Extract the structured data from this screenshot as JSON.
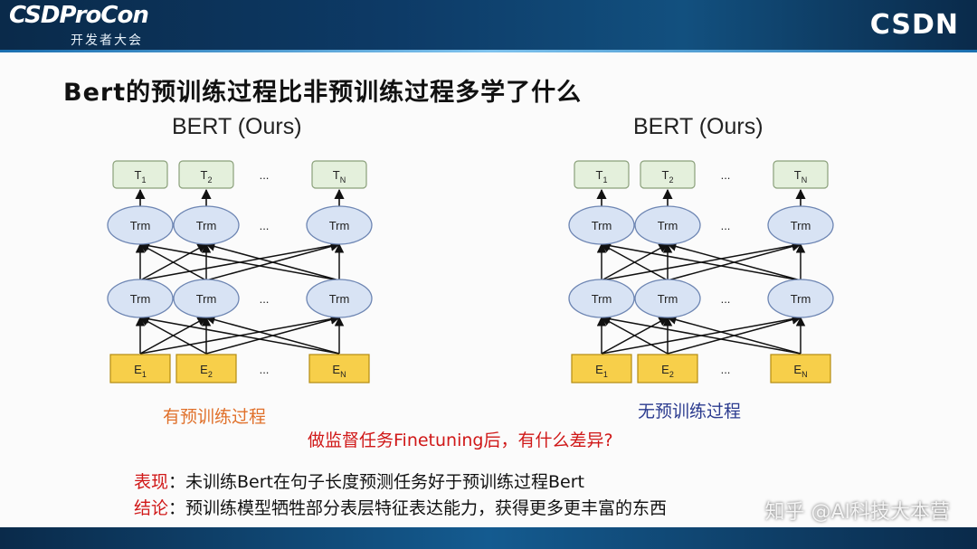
{
  "header": {
    "logo_main": "CSDProCon",
    "logo_sub": "开发者大会",
    "brand": "CSDN"
  },
  "title": "Bert的预训练过程比非预训练过程多学了什么",
  "diagrams": [
    {
      "heading": "BERT (Ours)",
      "caption": "有预训练过程"
    },
    {
      "heading": "BERT (Ours)",
      "caption": "无预训练过程"
    }
  ],
  "diagram_labels": {
    "outputs": [
      "T1",
      "T2",
      "...",
      "TN"
    ],
    "trm": "Trm",
    "ellipsis": "...",
    "inputs": [
      "E1",
      "E2",
      "...",
      "EN"
    ]
  },
  "question": "做监督任务Finetuning后，有什么差异?",
  "notes": [
    {
      "key": "表现",
      "text": "：未训练Bert在句子长度预测任务好于预训练过程Bert"
    },
    {
      "key": "结论",
      "text": "：预训练模型牺牲部分表层特征表达能力，获得更多更丰富的东西"
    }
  ],
  "watermark": "知乎 @AI科技大本营",
  "colors": {
    "title_bar": "#0d3a66",
    "output_box": "#e4f0dc",
    "trm_node": "#d8e3f4",
    "input_box": "#f7cf4a",
    "accent_red": "#d01818",
    "caption_orange": "#e0702a",
    "caption_blue": "#2b3b8f"
  }
}
